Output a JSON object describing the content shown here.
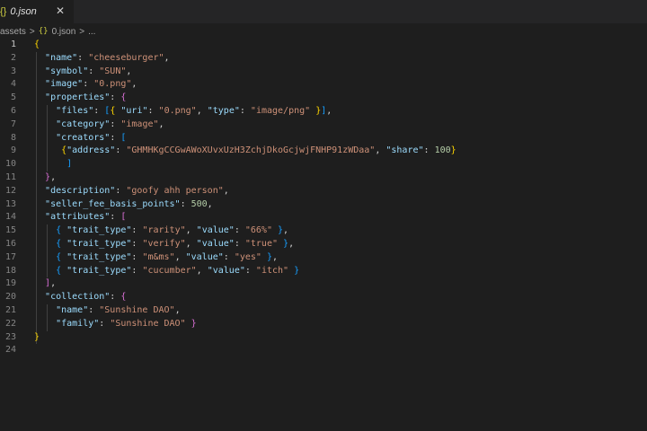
{
  "tab": {
    "icon": "{}",
    "title": "0.json",
    "close": "✕"
  },
  "breadcrumb": {
    "folder": "assets",
    "sep": ">",
    "icon": "{}",
    "file": "0.json",
    "more": "..."
  },
  "lines": [
    [
      [
        "b1",
        "{"
      ]
    ],
    [
      [
        "p",
        "  "
      ],
      [
        "k",
        "\"name\""
      ],
      [
        "p",
        ": "
      ],
      [
        "s",
        "\"cheeseburger\""
      ],
      [
        "p",
        ","
      ]
    ],
    [
      [
        "p",
        "  "
      ],
      [
        "k",
        "\"symbol\""
      ],
      [
        "p",
        ": "
      ],
      [
        "s",
        "\"SUN\""
      ],
      [
        "p",
        ","
      ]
    ],
    [
      [
        "p",
        "  "
      ],
      [
        "k",
        "\"image\""
      ],
      [
        "p",
        ": "
      ],
      [
        "s",
        "\"0.png\""
      ],
      [
        "p",
        ","
      ]
    ],
    [
      [
        "p",
        "  "
      ],
      [
        "k",
        "\"properties\""
      ],
      [
        "p",
        ": "
      ],
      [
        "b2",
        "{"
      ]
    ],
    [
      [
        "p",
        "    "
      ],
      [
        "k",
        "\"files\""
      ],
      [
        "p",
        ": "
      ],
      [
        "b3",
        "["
      ],
      [
        "b1",
        "{"
      ],
      [
        "p",
        " "
      ],
      [
        "k",
        "\"uri\""
      ],
      [
        "p",
        ": "
      ],
      [
        "s",
        "\"0.png\""
      ],
      [
        "p",
        ", "
      ],
      [
        "k",
        "\"type\""
      ],
      [
        "p",
        ": "
      ],
      [
        "s",
        "\"image/png\""
      ],
      [
        "p",
        " "
      ],
      [
        "b1",
        "}"
      ],
      [
        "b3",
        "]"
      ],
      [
        "p",
        ","
      ]
    ],
    [
      [
        "p",
        "    "
      ],
      [
        "k",
        "\"category\""
      ],
      [
        "p",
        ": "
      ],
      [
        "s",
        "\"image\""
      ],
      [
        "p",
        ","
      ]
    ],
    [
      [
        "p",
        "    "
      ],
      [
        "k",
        "\"creators\""
      ],
      [
        "p",
        ": "
      ],
      [
        "b3",
        "["
      ]
    ],
    [
      [
        "p",
        "     "
      ],
      [
        "b1",
        "{"
      ],
      [
        "k",
        "\"address\""
      ],
      [
        "p",
        ": "
      ],
      [
        "s",
        "\"GHMHKgCCGwAWoXUvxUzH3ZchjDkoGcjwjFNHP91zWDaa\""
      ],
      [
        "p",
        ", "
      ],
      [
        "k",
        "\"share\""
      ],
      [
        "p",
        ": "
      ],
      [
        "n",
        "100"
      ],
      [
        "b1",
        "}"
      ]
    ],
    [
      [
        "p",
        "      "
      ],
      [
        "b3",
        "]"
      ]
    ],
    [
      [
        "p",
        "  "
      ],
      [
        "b2",
        "}"
      ],
      [
        "p",
        ","
      ]
    ],
    [
      [
        "p",
        "  "
      ],
      [
        "k",
        "\"description\""
      ],
      [
        "p",
        ": "
      ],
      [
        "s",
        "\"goofy ahh person\""
      ],
      [
        "p",
        ","
      ]
    ],
    [
      [
        "p",
        "  "
      ],
      [
        "k",
        "\"seller_fee_basis_points\""
      ],
      [
        "p",
        ": "
      ],
      [
        "n",
        "500"
      ],
      [
        "p",
        ","
      ]
    ],
    [
      [
        "p",
        "  "
      ],
      [
        "k",
        "\"attributes\""
      ],
      [
        "p",
        ": "
      ],
      [
        "b2",
        "["
      ]
    ],
    [
      [
        "p",
        "    "
      ],
      [
        "b3",
        "{"
      ],
      [
        "p",
        " "
      ],
      [
        "k",
        "\"trait_type\""
      ],
      [
        "p",
        ": "
      ],
      [
        "s",
        "\"rarity\""
      ],
      [
        "p",
        ", "
      ],
      [
        "k",
        "\"value\""
      ],
      [
        "p",
        ": "
      ],
      [
        "s",
        "\"66%\""
      ],
      [
        "p",
        " "
      ],
      [
        "b3",
        "}"
      ],
      [
        "p",
        ","
      ]
    ],
    [
      [
        "p",
        "    "
      ],
      [
        "b3",
        "{"
      ],
      [
        "p",
        " "
      ],
      [
        "k",
        "\"trait_type\""
      ],
      [
        "p",
        ": "
      ],
      [
        "s",
        "\"verify\""
      ],
      [
        "p",
        ", "
      ],
      [
        "k",
        "\"value\""
      ],
      [
        "p",
        ": "
      ],
      [
        "s",
        "\"true\""
      ],
      [
        "p",
        " "
      ],
      [
        "b3",
        "}"
      ],
      [
        "p",
        ","
      ]
    ],
    [
      [
        "p",
        "    "
      ],
      [
        "b3",
        "{"
      ],
      [
        "p",
        " "
      ],
      [
        "k",
        "\"trait_type\""
      ],
      [
        "p",
        ": "
      ],
      [
        "s",
        "\"m&ms\""
      ],
      [
        "p",
        ", "
      ],
      [
        "k",
        "\"value\""
      ],
      [
        "p",
        ": "
      ],
      [
        "s",
        "\"yes\""
      ],
      [
        "p",
        " "
      ],
      [
        "b3",
        "}"
      ],
      [
        "p",
        ","
      ]
    ],
    [
      [
        "p",
        "    "
      ],
      [
        "b3",
        "{"
      ],
      [
        "p",
        " "
      ],
      [
        "k",
        "\"trait_type\""
      ],
      [
        "p",
        ": "
      ],
      [
        "s",
        "\"cucumber\""
      ],
      [
        "p",
        ", "
      ],
      [
        "k",
        "\"value\""
      ],
      [
        "p",
        ": "
      ],
      [
        "s",
        "\"itch\""
      ],
      [
        "p",
        " "
      ],
      [
        "b3",
        "}"
      ]
    ],
    [
      [
        "p",
        "  "
      ],
      [
        "b2",
        "]"
      ],
      [
        "p",
        ","
      ]
    ],
    [
      [
        "p",
        "  "
      ],
      [
        "k",
        "\"collection\""
      ],
      [
        "p",
        ": "
      ],
      [
        "b2",
        "{"
      ]
    ],
    [
      [
        "p",
        "    "
      ],
      [
        "k",
        "\"name\""
      ],
      [
        "p",
        ": "
      ],
      [
        "s",
        "\"Sunshine DAO\""
      ],
      [
        "p",
        ","
      ]
    ],
    [
      [
        "p",
        "    "
      ],
      [
        "k",
        "\"family\""
      ],
      [
        "p",
        ": "
      ],
      [
        "s",
        "\"Sunshine DAO\""
      ],
      [
        "p",
        " "
      ],
      [
        "b2",
        "}"
      ]
    ],
    [
      [
        "b1",
        "}"
      ]
    ],
    []
  ],
  "colors": {
    "key": "#9cdcfe",
    "string": "#ce9178",
    "number": "#b5cea8",
    "bracket1": "#ffd700",
    "bracket2": "#da70d6",
    "bracket3": "#179fff"
  }
}
